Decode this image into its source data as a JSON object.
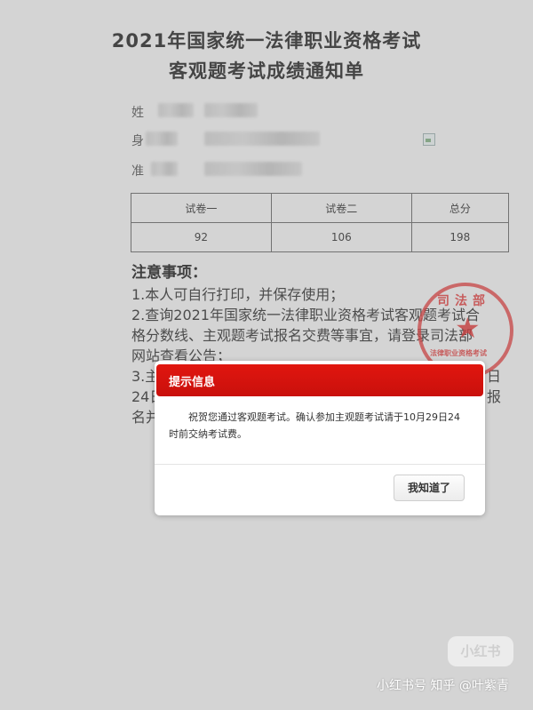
{
  "document": {
    "title_line1": "2021年国家统一法律职业资格考试",
    "title_line2": "客观题考试成绩通知单",
    "info_labels": [
      "姓",
      "身",
      "准"
    ],
    "scores": {
      "headers": [
        "试卷一",
        "试卷二",
        "总分"
      ],
      "values": [
        "92",
        "106",
        "198"
      ]
    },
    "notes_title": "注意事项：",
    "notes": [
      "1.本人可自行打印，并保存使用；",
      "2.查询2021年国家统一法律职业资格考试客观题考试合",
      "格分数线、主观题考试报名交费等事宜，请登录司法部",
      "网站查看公告；",
      "3.主",
      "24日",
      "名并"
    ],
    "note_tails": [
      "日",
      "报"
    ],
    "stamp": {
      "top_text": "司法部",
      "bottom_text": "法律职业资格考试"
    }
  },
  "dialog": {
    "title": "提示信息",
    "message": "祝贺您通过客观题考试。确认参加主观题考试请于10月29日24时前交纳考试费。",
    "ok_label": "我知道了"
  },
  "watermark": {
    "logo": "小红书",
    "text": "小红书号 知乎 @叶紫青"
  },
  "colors": {
    "dialog_header": "#d4120d",
    "stamp": "#d62828",
    "background": "#e9e9e9"
  }
}
